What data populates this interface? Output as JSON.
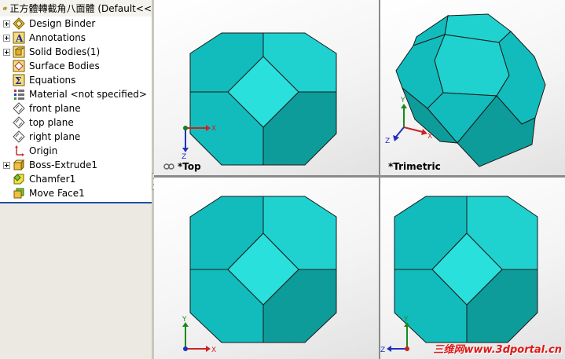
{
  "tree": {
    "title": "正方體轉截角八面體 (Default<<",
    "items": [
      {
        "label": "Design Binder",
        "icon": "design-binder-icon",
        "expandable": true
      },
      {
        "label": "Annotations",
        "icon": "annotations-icon",
        "expandable": true
      },
      {
        "label": "Solid Bodies(1)",
        "icon": "solid-bodies-icon",
        "expandable": true
      },
      {
        "label": "Surface Bodies",
        "icon": "surface-bodies-icon",
        "expandable": false
      },
      {
        "label": "Equations",
        "icon": "equations-icon",
        "expandable": false
      },
      {
        "label": "Material <not specified>",
        "icon": "material-icon",
        "expandable": false
      },
      {
        "label": "front plane",
        "icon": "plane-icon",
        "expandable": false
      },
      {
        "label": "top plane",
        "icon": "plane-icon",
        "expandable": false
      },
      {
        "label": "right plane",
        "icon": "plane-icon",
        "expandable": false
      },
      {
        "label": "Origin",
        "icon": "origin-icon",
        "expandable": false
      },
      {
        "label": "Boss-Extrude1",
        "icon": "extrude-icon",
        "expandable": true
      },
      {
        "label": "Chamfer1",
        "icon": "chamfer-icon",
        "expandable": false
      },
      {
        "label": "Move Face1",
        "icon": "move-face-icon",
        "expandable": false
      }
    ]
  },
  "viewports": {
    "top": {
      "label": "*Top"
    },
    "trimetric": {
      "label": "*Trimetric"
    },
    "axes": {
      "x": "X",
      "y": "Y",
      "z": "Z"
    }
  },
  "watermark": "三维网www.3dportal.cn",
  "colors": {
    "face_light": "#1fd2d0",
    "face_main": "#12bcbc",
    "face_dark": "#0d9c9a",
    "face_highlight": "#29e0dc",
    "tree_rule": "#1f4fa8",
    "watermark": "#e01818"
  }
}
